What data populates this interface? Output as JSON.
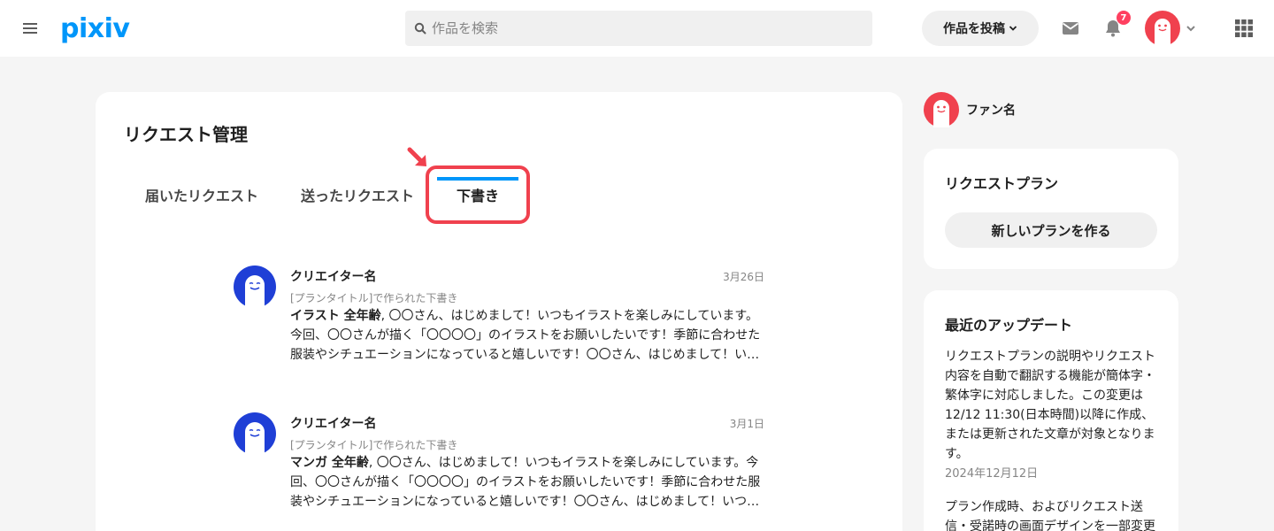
{
  "header": {
    "logo": "pixiv",
    "search_placeholder": "作品を検索",
    "post_label": "作品を投稿",
    "notification_count": "7"
  },
  "main": {
    "title": "リクエスト管理",
    "tabs": [
      {
        "label": "届いたリクエスト"
      },
      {
        "label": "送ったリクエスト"
      },
      {
        "label": "下書き"
      }
    ],
    "requests": [
      {
        "creator": "クリエイター名",
        "date": "3月26日",
        "plan": "[プランタイトル]で作られた下書き",
        "tag": "イラスト 全年齢",
        "text": ", 〇〇さん、はじめまして！いつもイラストを楽しみにしています。今回、〇〇さんが描く「〇〇〇〇」のイラストをお願いしたいです！季節に合わせた服装やシチュエーションになっていると嬉しいです！〇〇さん、はじめまして！い…"
      },
      {
        "creator": "クリエイター名",
        "date": "3月1日",
        "plan": "[プランタイトル]で作られた下書き",
        "tag": "マンガ 全年齢",
        "text": ", 〇〇さん、はじめまして！いつもイラストを楽しみにしています。今回、〇〇さんが描く「〇〇〇〇」のイラストをお願いしたいです！季節に合わせた服装やシチュエーションになっていると嬉しいです！〇〇さん、はじめまして！いつ…"
      }
    ]
  },
  "sidebar": {
    "fan_name": "ファン名",
    "plan_card_title": "リクエストプラン",
    "new_plan_label": "新しいプランを作る",
    "updates_title": "最近のアップデート",
    "update_text": "リクエストプランの説明やリクエスト内容を自動で翻訳する機能が簡体字・繁体字に対応しました。この変更は12/12 11:30(日本時間)以降に作成、または更新された文章が対象となります。",
    "update_date": "2024年12月12日",
    "update_text2": "プラン作成時、およびリクエスト送信・受諾時の画面デザインを一部変更"
  },
  "colors": {
    "brand": "#0096fa",
    "highlight": "#f0414e",
    "badge": "#ff4060",
    "fan_avatar": "#f0414e",
    "creator_avatar": "#1f3fd6"
  },
  "icons": [
    "menu-icon",
    "search-icon",
    "chevron-down-icon",
    "mail-icon",
    "bell-icon",
    "grid-icon"
  ]
}
